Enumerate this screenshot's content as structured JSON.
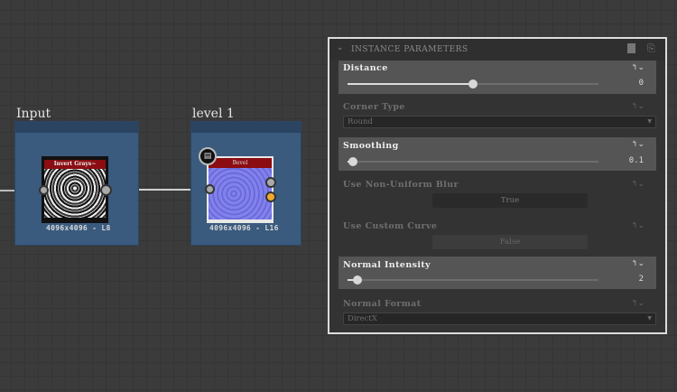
{
  "graph": {
    "nodes": [
      {
        "frame_title": "Input",
        "node_title": "Invert Grays~",
        "resolution": "4096x4096 - L8"
      },
      {
        "frame_title": "level 1",
        "node_title": "Bevel",
        "resolution": "4096x4096 - L16"
      }
    ]
  },
  "panel": {
    "title": "INSTANCE PARAMETERS",
    "params": [
      {
        "label": "Distance",
        "type": "slider",
        "value": "0",
        "fraction": 0.5
      },
      {
        "label": "Corner Type",
        "type": "dropdown",
        "value": "Round"
      },
      {
        "label": "Smoothing",
        "type": "slider",
        "value": "0.1",
        "fraction": 0.02
      },
      {
        "label": "Use Non-Uniform Blur",
        "type": "toggle",
        "value": "True"
      },
      {
        "label": "Use Custom Curve",
        "type": "toggle",
        "value": "False"
      },
      {
        "label": "Normal Intensity",
        "type": "slider",
        "value": "2",
        "fraction": 0.04
      },
      {
        "label": "Normal Format",
        "type": "dropdown",
        "value": "DirectX"
      }
    ]
  },
  "colors": {
    "node_header": "#8b0d12",
    "frame": "#3a5a7e",
    "accent_port": "#f0a830"
  }
}
